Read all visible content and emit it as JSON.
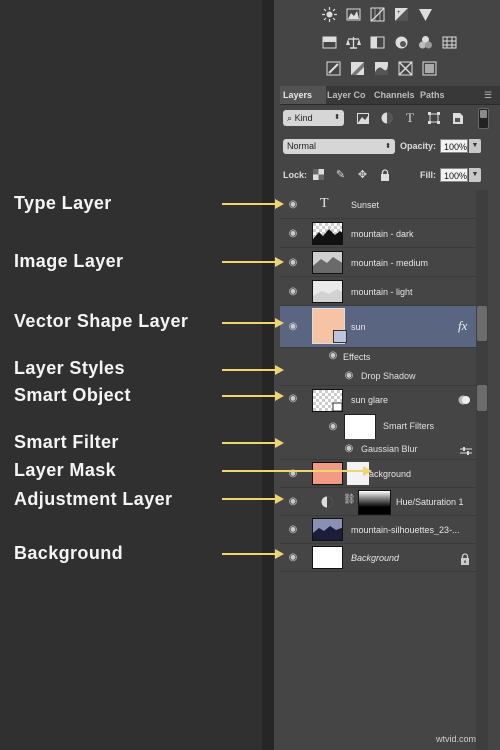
{
  "annotations": [
    {
      "label": "Type Layer"
    },
    {
      "label": "Image Layer"
    },
    {
      "label": "Vector Shape Layer"
    },
    {
      "label": "Layer Styles"
    },
    {
      "label": "Smart Object"
    },
    {
      "label": "Smart Filter"
    },
    {
      "label": "Layer Mask"
    },
    {
      "label": "Adjustment Layer"
    },
    {
      "label": "Background"
    }
  ],
  "tabs": [
    {
      "label": "Layers",
      "active": true
    },
    {
      "label": "Layer Co",
      "active": false
    },
    {
      "label": "Channels",
      "active": false
    },
    {
      "label": "Paths",
      "active": false
    }
  ],
  "filter": {
    "kind_label": "Kind"
  },
  "blend": {
    "mode": "Normal",
    "opacity_label": "Opacity:",
    "opacity_value": "100%"
  },
  "lock": {
    "label": "Lock:",
    "fill_label": "Fill:",
    "fill_value": "100%"
  },
  "layers": {
    "sunset": "Sunset",
    "mountain_dark": "mountain - dark",
    "mountain_medium": "mountain - medium",
    "mountain_light": "mountain - light",
    "sun": "sun",
    "effects": "Effects",
    "drop_shadow": "Drop Shadow",
    "sun_glare": "sun glare",
    "smart_filters": "Smart Filters",
    "gaussian_blur": "Gaussian Blur",
    "background_layer": "background",
    "hue_saturation": "Hue/Saturation 1",
    "silhouettes": "mountain-silhouettes_23-...",
    "background": "Background"
  },
  "fx_label": "fx",
  "type_glyph": "T",
  "watermark": "wtvid.com",
  "colors": {
    "accent_arrow": "#f0d472",
    "selected_row": "#5a6582",
    "panel_bg": "#454545"
  }
}
